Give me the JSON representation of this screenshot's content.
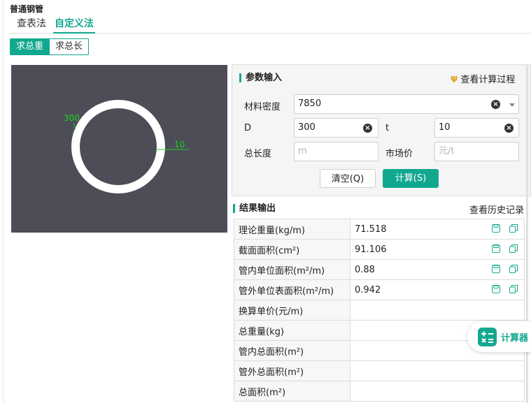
{
  "header": {
    "title": "普通钢管"
  },
  "tabs": [
    {
      "label": "查表法",
      "active": false
    },
    {
      "label": "自定义法",
      "active": true
    }
  ],
  "modes": [
    {
      "label": "求总重",
      "active": true
    },
    {
      "label": "求总长",
      "active": false
    }
  ],
  "preview": {
    "diameter_label": "300",
    "thickness_label": "10",
    "background": "#4c4d57",
    "label_color": "#19d419"
  },
  "params": {
    "title": "参数输入",
    "view_process_label": "查看计算过程",
    "density": {
      "label": "材料密度",
      "value": "7850"
    },
    "D": {
      "label": "D",
      "value": "300"
    },
    "t": {
      "label": "t",
      "value": "10"
    },
    "length": {
      "label": "总长度",
      "placeholder": "m"
    },
    "price": {
      "label": "市场价",
      "placeholder": "元/t"
    },
    "clear_button": "清空(Q)",
    "calc_button": "计算(S)"
  },
  "results": {
    "title": "结果输出",
    "history_label": "查看历史记录",
    "rows": [
      {
        "label": "理论重量(kg/m)",
        "value": "71.518"
      },
      {
        "label": "截面面积(cm²)",
        "value": "91.106"
      },
      {
        "label": "管内单位面积(m²/m)",
        "value": "0.88"
      },
      {
        "label": "管外单位表面积(m²/m)",
        "value": "0.942"
      },
      {
        "label": "换算单价(元/m)",
        "value": ""
      },
      {
        "label": "总重量(kg)",
        "value": ""
      },
      {
        "label": "管内总面积(m²)",
        "value": ""
      },
      {
        "label": "管外总面积(m²)",
        "value": ""
      },
      {
        "label": "总面积(m²)",
        "value": ""
      }
    ]
  },
  "floating": {
    "label": "计算器"
  },
  "colors": {
    "accent": "#12a88f"
  }
}
